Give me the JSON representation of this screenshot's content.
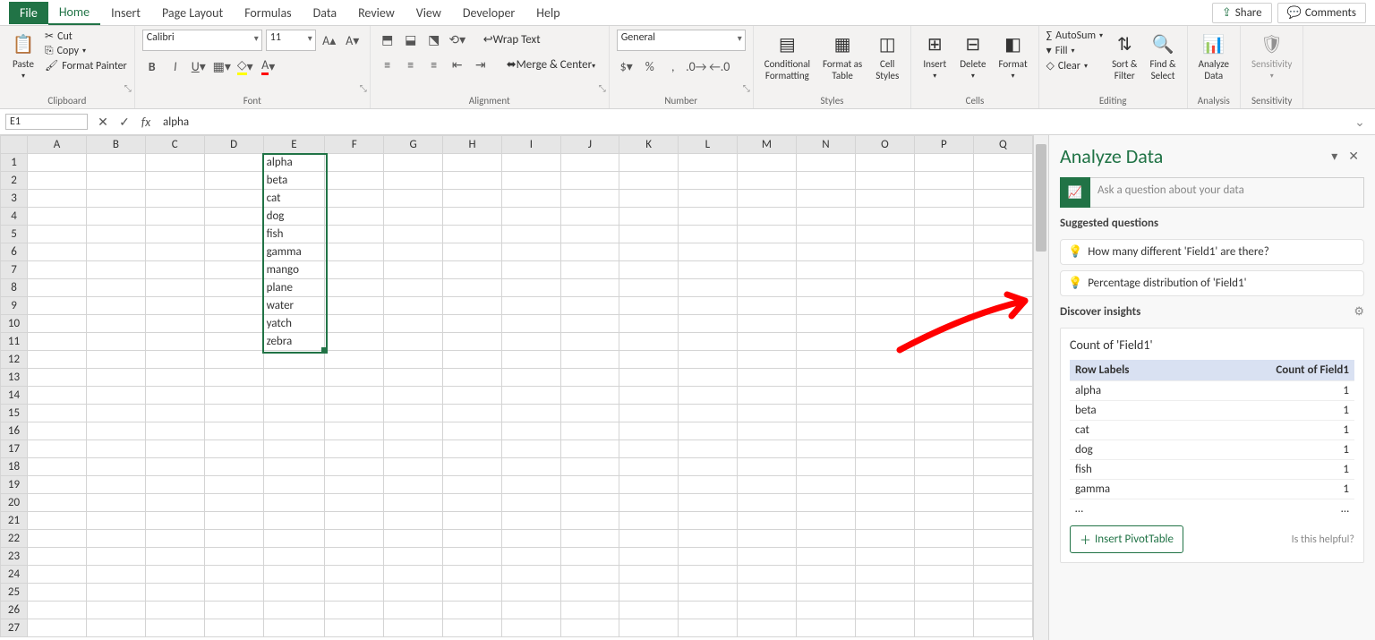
{
  "tabs": {
    "file": "File",
    "home": "Home",
    "insert": "Insert",
    "pageLayout": "Page Layout",
    "formulas": "Formulas",
    "data": "Data",
    "review": "Review",
    "view": "View",
    "developer": "Developer",
    "help": "Help"
  },
  "topRight": {
    "share": "Share",
    "comments": "Comments"
  },
  "ribbon": {
    "clipboard": {
      "label": "Clipboard",
      "paste": "Paste",
      "cut": "Cut",
      "copy": "Copy",
      "formatPainter": "Format Painter"
    },
    "font": {
      "label": "Font",
      "name": "Calibri",
      "size": "11"
    },
    "alignment": {
      "label": "Alignment",
      "wrap": "Wrap Text",
      "merge": "Merge & Center"
    },
    "number": {
      "label": "Number",
      "format": "General"
    },
    "styles": {
      "label": "Styles",
      "cond": "Conditional\nFormatting",
      "table": "Format as\nTable",
      "cell": "Cell\nStyles"
    },
    "cells": {
      "label": "Cells",
      "insert": "Insert",
      "delete": "Delete",
      "format": "Format"
    },
    "editing": {
      "label": "Editing",
      "autosum": "AutoSum",
      "fill": "Fill",
      "clear": "Clear",
      "sort": "Sort &\nFilter",
      "find": "Find &\nSelect"
    },
    "analysis": {
      "label": "Analysis",
      "analyze": "Analyze\nData"
    },
    "sensitivity": {
      "label": "Sensitivity",
      "btn": "Sensitivity"
    }
  },
  "nameBox": "E1",
  "formula": "alpha",
  "columns": [
    "A",
    "B",
    "C",
    "D",
    "E",
    "F",
    "G",
    "H",
    "I",
    "J",
    "K",
    "L",
    "M",
    "N",
    "O",
    "P",
    "Q"
  ],
  "rows": 27,
  "cellData": {
    "E1": "alpha",
    "E2": "beta",
    "E3": "cat",
    "E4": "dog",
    "E5": "fish",
    "E6": "gamma",
    "E7": "mango",
    "E8": "plane",
    "E9": "water",
    "E10": "yatch",
    "E11": "zebra"
  },
  "selection": {
    "col": "E",
    "from": 1,
    "to": 11,
    "active": 1
  },
  "pane": {
    "title": "Analyze Data",
    "askPlaceholder": "Ask a question about your data",
    "suggestedLabel": "Suggested questions",
    "suggestions": [
      "How many different 'Field1' are there?",
      "Percentage distribution of 'Field1'"
    ],
    "discoverLabel": "Discover insights",
    "insightTitle": "Count of 'Field1'",
    "tableHeaders": {
      "row": "Row Labels",
      "count": "Count of Field1"
    },
    "tableRows": [
      [
        "alpha",
        "1"
      ],
      [
        "beta",
        "1"
      ],
      [
        "cat",
        "1"
      ],
      [
        "dog",
        "1"
      ],
      [
        "fish",
        "1"
      ],
      [
        "gamma",
        "1"
      ]
    ],
    "more": "…",
    "pivotBtn": "Insert PivotTable",
    "helpful": "Is this helpful?"
  }
}
